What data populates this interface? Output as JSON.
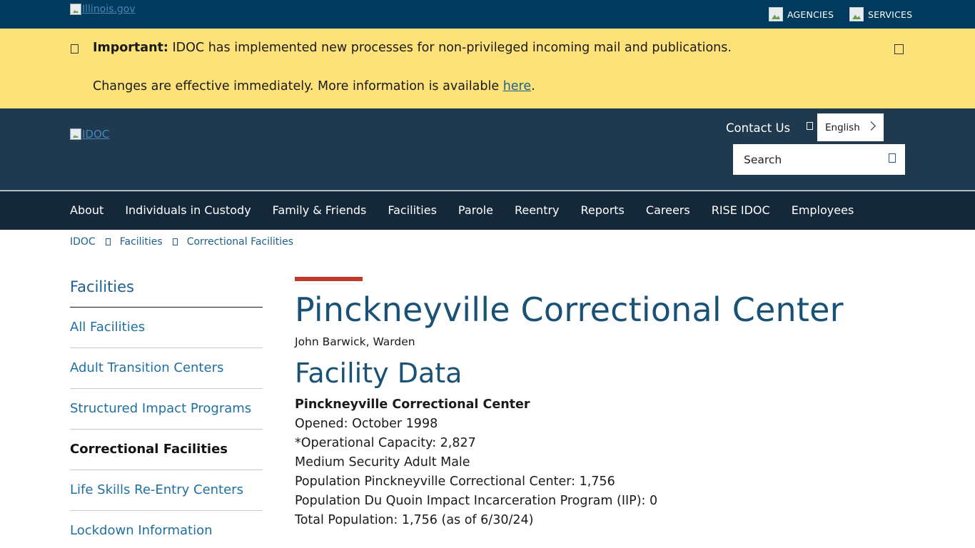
{
  "topbar": {
    "logo_alt": "Illinois.gov",
    "agencies": "AGENCIES",
    "services": "SERVICES"
  },
  "alert": {
    "label": "Important:",
    "message": "IDOC has implemented new processes for non-privileged incoming mail and publications.",
    "line2_text": "Changes are effective immediately. More information is available",
    "link_text": "here",
    "line2_end": "."
  },
  "header": {
    "logo_alt": "IDOC",
    "contact": "Contact Us",
    "language": "English",
    "search_placeholder": "Search"
  },
  "nav": {
    "items": [
      "About",
      "Individuals in Custody",
      "Family & Friends",
      "Facilities",
      "Parole",
      "Reentry",
      "Reports",
      "Careers",
      "RISE IDOC",
      "Employees"
    ]
  },
  "breadcrumb": [
    "IDOC",
    "Facilities",
    "Correctional Facilities"
  ],
  "sidebar": {
    "title": "Facilities",
    "items": [
      {
        "label": "All Facilities",
        "active": false
      },
      {
        "label": "Adult Transition Centers",
        "active": false
      },
      {
        "label": "Structured Impact Programs",
        "active": false
      },
      {
        "label": "Correctional Facilities",
        "active": true
      },
      {
        "label": "Life Skills Re-Entry Centers",
        "active": false
      },
      {
        "label": "Lockdown Information",
        "active": false
      }
    ]
  },
  "main": {
    "title": "Pinckneyville Correctional Center",
    "warden": "John Barwick, Warden",
    "section_title": "Facility Data",
    "facility_name": "Pinckneyville Correctional Center",
    "facts": [
      "Opened: October 1998",
      "*Operational Capacity: 2,827",
      "Medium Security Adult Male",
      "Population Pinckneyville Correctional Center: 1,756",
      "Population Du Quoin Impact Incarceration Program (IIP): 0",
      "Total Population: 1,756 (as of 6/30/24)"
    ]
  },
  "colors": {
    "topbar": "#003a5d",
    "alert": "#fde27a",
    "header": "#1f3a4f",
    "nav": "#15283a",
    "accent": "#c0392b",
    "heading": "#1a5276",
    "link": "#1f6fa3"
  }
}
